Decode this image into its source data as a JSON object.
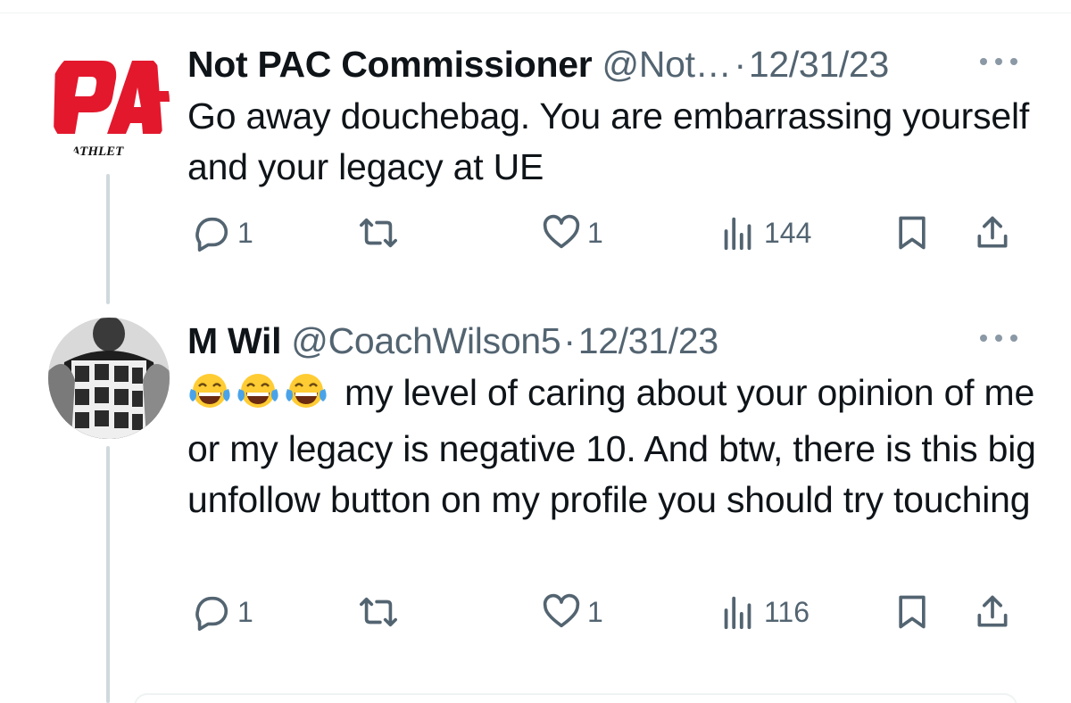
{
  "thread": {
    "tweets": [
      {
        "name": "Not PAC Commissioner",
        "handle": "@Not…",
        "separator": "·",
        "date": "12/31/23",
        "text": "Go away douchebag. You are embarrassing yourself and your legacy at UE",
        "avatar_logo_text": "ATHLET",
        "stats": {
          "replies": "1",
          "retweets": "",
          "likes": "1",
          "views": "144"
        }
      },
      {
        "name": "M Wil",
        "handle": "@CoachWilson5",
        "separator": "·",
        "date": "12/31/23",
        "emoji_prefix": "😂😂😂",
        "text": "my level of caring about your opinion of me or my legacy is negative 10. And btw, there is this big unfollow button on my profile you should try touching",
        "stats": {
          "replies": "1",
          "retweets": "",
          "likes": "1",
          "views": "116"
        }
      }
    ]
  },
  "colors": {
    "text_primary": "#0f1419",
    "text_secondary": "#536471",
    "thread_line": "#cfd9de",
    "logo_red": "#e3182d"
  },
  "icons": {
    "reply": "reply-icon",
    "retweet": "retweet-icon",
    "like": "heart-icon",
    "views": "views-icon",
    "bookmark": "bookmark-icon",
    "share": "share-icon",
    "more": "more-icon",
    "emoji": "tears-of-joy-emoji"
  }
}
